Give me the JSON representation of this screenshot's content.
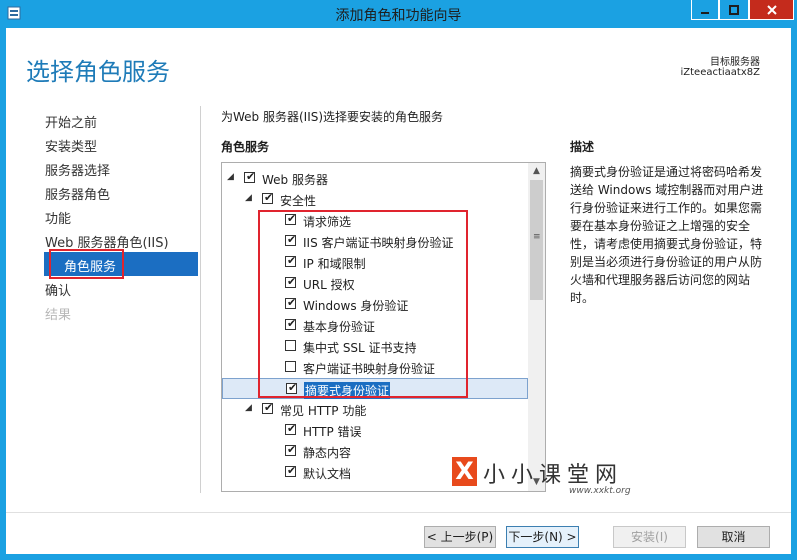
{
  "window": {
    "title": "添加角色和功能向导",
    "controls": {
      "minimize": "—",
      "maximize": "☐",
      "close": "✕"
    }
  },
  "header": {
    "page_title": "选择角色服务",
    "target_label": "目标服务器",
    "target_name": "iZteeactiaatx8Z"
  },
  "steps": [
    {
      "label": "开始之前",
      "state": "normal"
    },
    {
      "label": "安装类型",
      "state": "normal"
    },
    {
      "label": "服务器选择",
      "state": "normal"
    },
    {
      "label": "服务器角色",
      "state": "normal"
    },
    {
      "label": "功能",
      "state": "normal"
    },
    {
      "label": "Web 服务器角色(IIS)",
      "state": "normal"
    },
    {
      "label": "角色服务",
      "state": "active"
    },
    {
      "label": "确认",
      "state": "normal"
    },
    {
      "label": "结果",
      "state": "disabled"
    }
  ],
  "main": {
    "intro": "为Web 服务器(IIS)选择要安装的角色服务",
    "section_heading": "角色服务",
    "tree": [
      {
        "label": "Web 服务器",
        "checked": true,
        "expander": "◢",
        "level": 0
      },
      {
        "label": "安全性",
        "checked": true,
        "expander": "◢",
        "level": 1
      },
      {
        "label": "请求筛选",
        "checked": true,
        "expander": "",
        "level": 2
      },
      {
        "label": "IIS 客户端证书映射身份验证",
        "checked": true,
        "expander": "",
        "level": 2
      },
      {
        "label": "IP 和域限制",
        "checked": true,
        "expander": "",
        "level": 2
      },
      {
        "label": "URL 授权",
        "checked": true,
        "expander": "",
        "level": 2
      },
      {
        "label": "Windows 身份验证",
        "checked": true,
        "expander": "",
        "level": 2
      },
      {
        "label": "基本身份验证",
        "checked": true,
        "expander": "",
        "level": 2
      },
      {
        "label": "集中式 SSL 证书支持",
        "checked": false,
        "expander": "",
        "level": 2
      },
      {
        "label": "客户端证书映射身份验证",
        "checked": false,
        "expander": "",
        "level": 2
      },
      {
        "label": "摘要式身份验证",
        "checked": true,
        "expander": "",
        "level": 2,
        "selected": true
      },
      {
        "label": "常见 HTTP 功能",
        "checked": true,
        "expander": "◢",
        "level": 1
      },
      {
        "label": "HTTP 错误",
        "checked": true,
        "expander": "",
        "level": 2
      },
      {
        "label": "静态内容",
        "checked": true,
        "expander": "",
        "level": 2
      },
      {
        "label": "默认文档",
        "checked": true,
        "expander": "",
        "level": 2
      }
    ],
    "checkmark": "✔",
    "scroll": {
      "up": "▲",
      "down": "▼",
      "grip": "≡"
    }
  },
  "description": {
    "heading": "描述",
    "text": "摘要式身份验证是通过将密码哈希发送给 Windows 域控制器而对用户进行身份验证来进行工作的。如果您需要在基本身份验证之上增强的安全性，请考虑使用摘要式身份验证，特别是当必须进行身份验证的用户从防火墙和代理服务器后访问您的网站时。"
  },
  "watermark": {
    "logo": "X",
    "text": "小小课堂网",
    "url": "www.xxkt.org"
  },
  "footer": {
    "prev": "< 上一步(P)",
    "next": "下一步(N) >",
    "install": "安装(I)",
    "cancel": "取消"
  },
  "colors": {
    "titlebar": "#1ba1e2",
    "accent": "#1b6ec2",
    "highlight_box": "#e0242e",
    "close_button": "#c42b1c"
  }
}
